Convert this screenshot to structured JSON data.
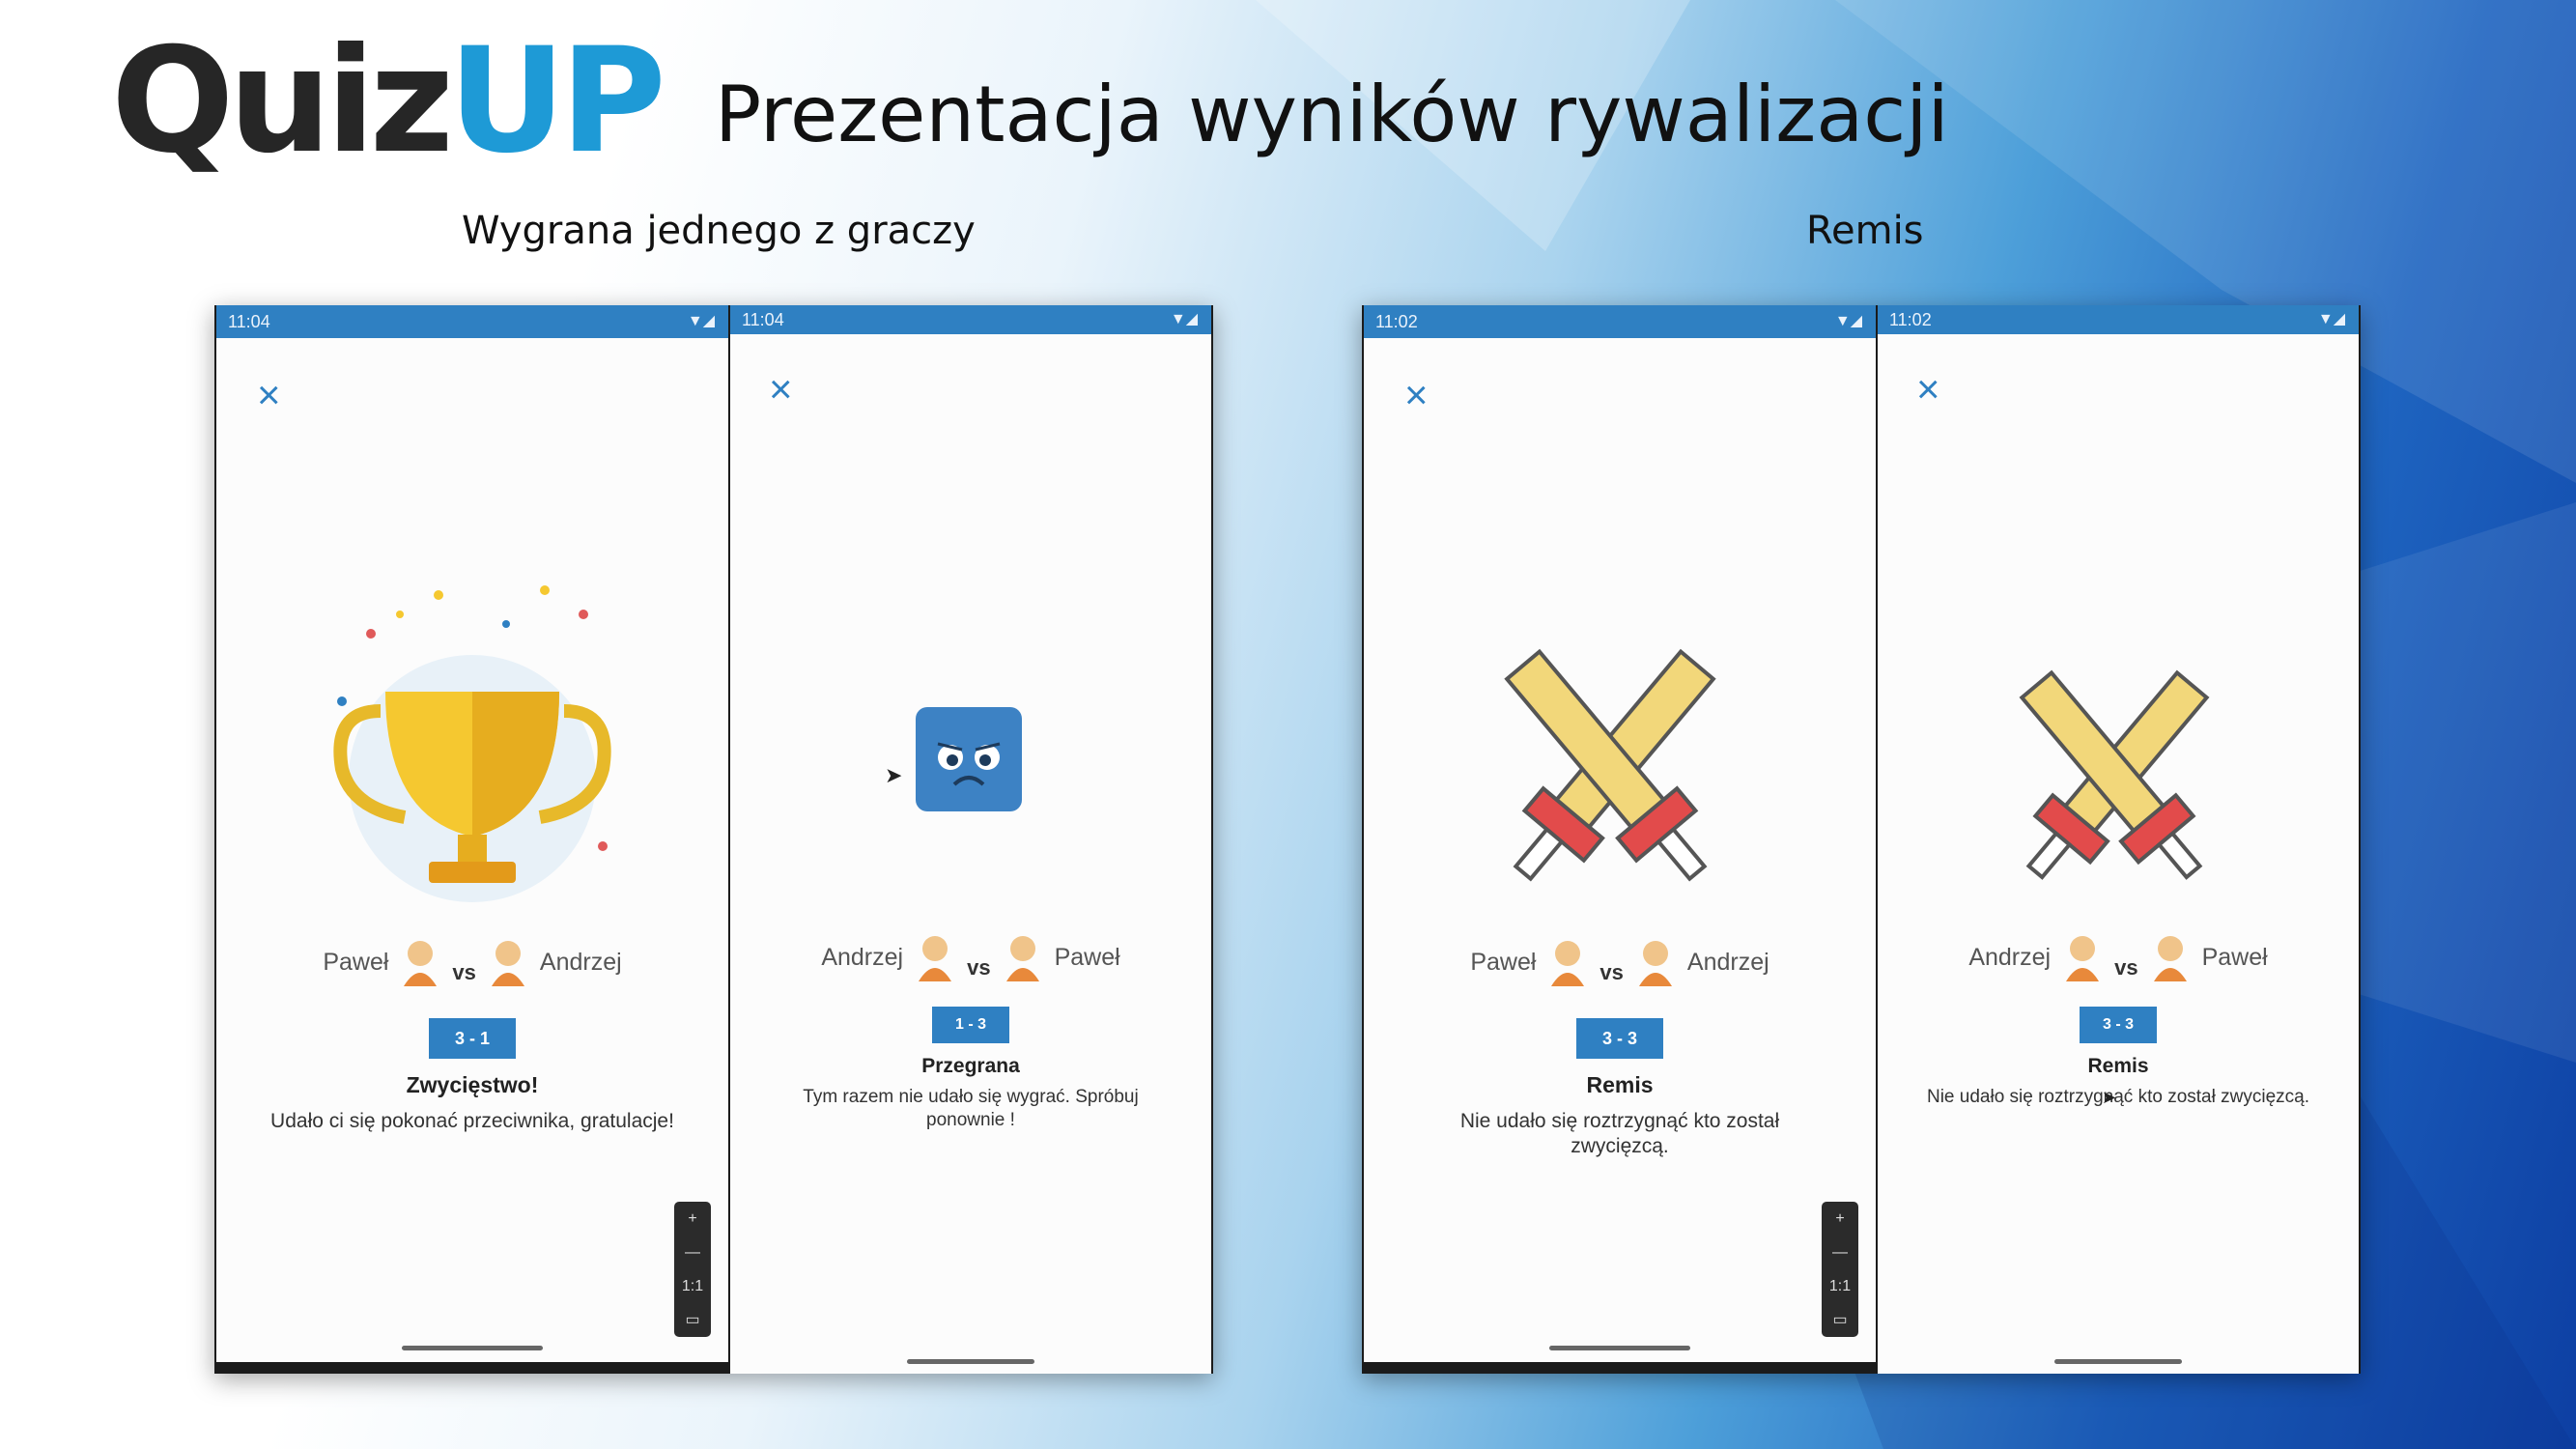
{
  "brand": {
    "part1": "Quiz",
    "part2": "UP"
  },
  "title": "Prezentacja wyników rywalizacji",
  "sections": {
    "left": "Wygrana jednego z graczy",
    "right": "Remis"
  },
  "screens": {
    "win": {
      "time": "11:04",
      "player_left": "Paweł",
      "vs": "vs",
      "player_right": "Andrzej",
      "score": "3 - 1",
      "result": "Zwycięstwo!",
      "desc": "Udało ci się pokonać przeciwnika, gratulacje!",
      "close": "×",
      "illustration": "trophy-icon"
    },
    "lose": {
      "time": "11:04",
      "player_left": "Andrzej",
      "vs": "vs",
      "player_right": "Paweł",
      "score": "1 - 3",
      "result": "Przegrana",
      "desc": "Tym razem nie udało się wygrać. Spróbuj ponownie !",
      "close": "×",
      "illustration": "sad-face-icon"
    },
    "draw1": {
      "time": "11:02",
      "player_left": "Paweł",
      "vs": "vs",
      "player_right": "Andrzej",
      "score": "3 - 3",
      "result": "Remis",
      "desc": "Nie udało się roztrzygnąć kto został zwycięzcą.",
      "close": "×",
      "illustration": "crossed-swords-icon"
    },
    "draw2": {
      "time": "11:02",
      "player_left": "Andrzej",
      "vs": "vs",
      "player_right": "Paweł",
      "score": "3 - 3",
      "result": "Remis",
      "desc": "Nie udało się roztrzygnąć kto został zwycięzcą.",
      "close": "×",
      "illustration": "crossed-swords-icon"
    }
  },
  "zoom": {
    "plus": "+",
    "minus": "—",
    "reset": "1:1"
  },
  "colors": {
    "accent": "#2f80c2",
    "logo_up": "#1e9ad6"
  }
}
